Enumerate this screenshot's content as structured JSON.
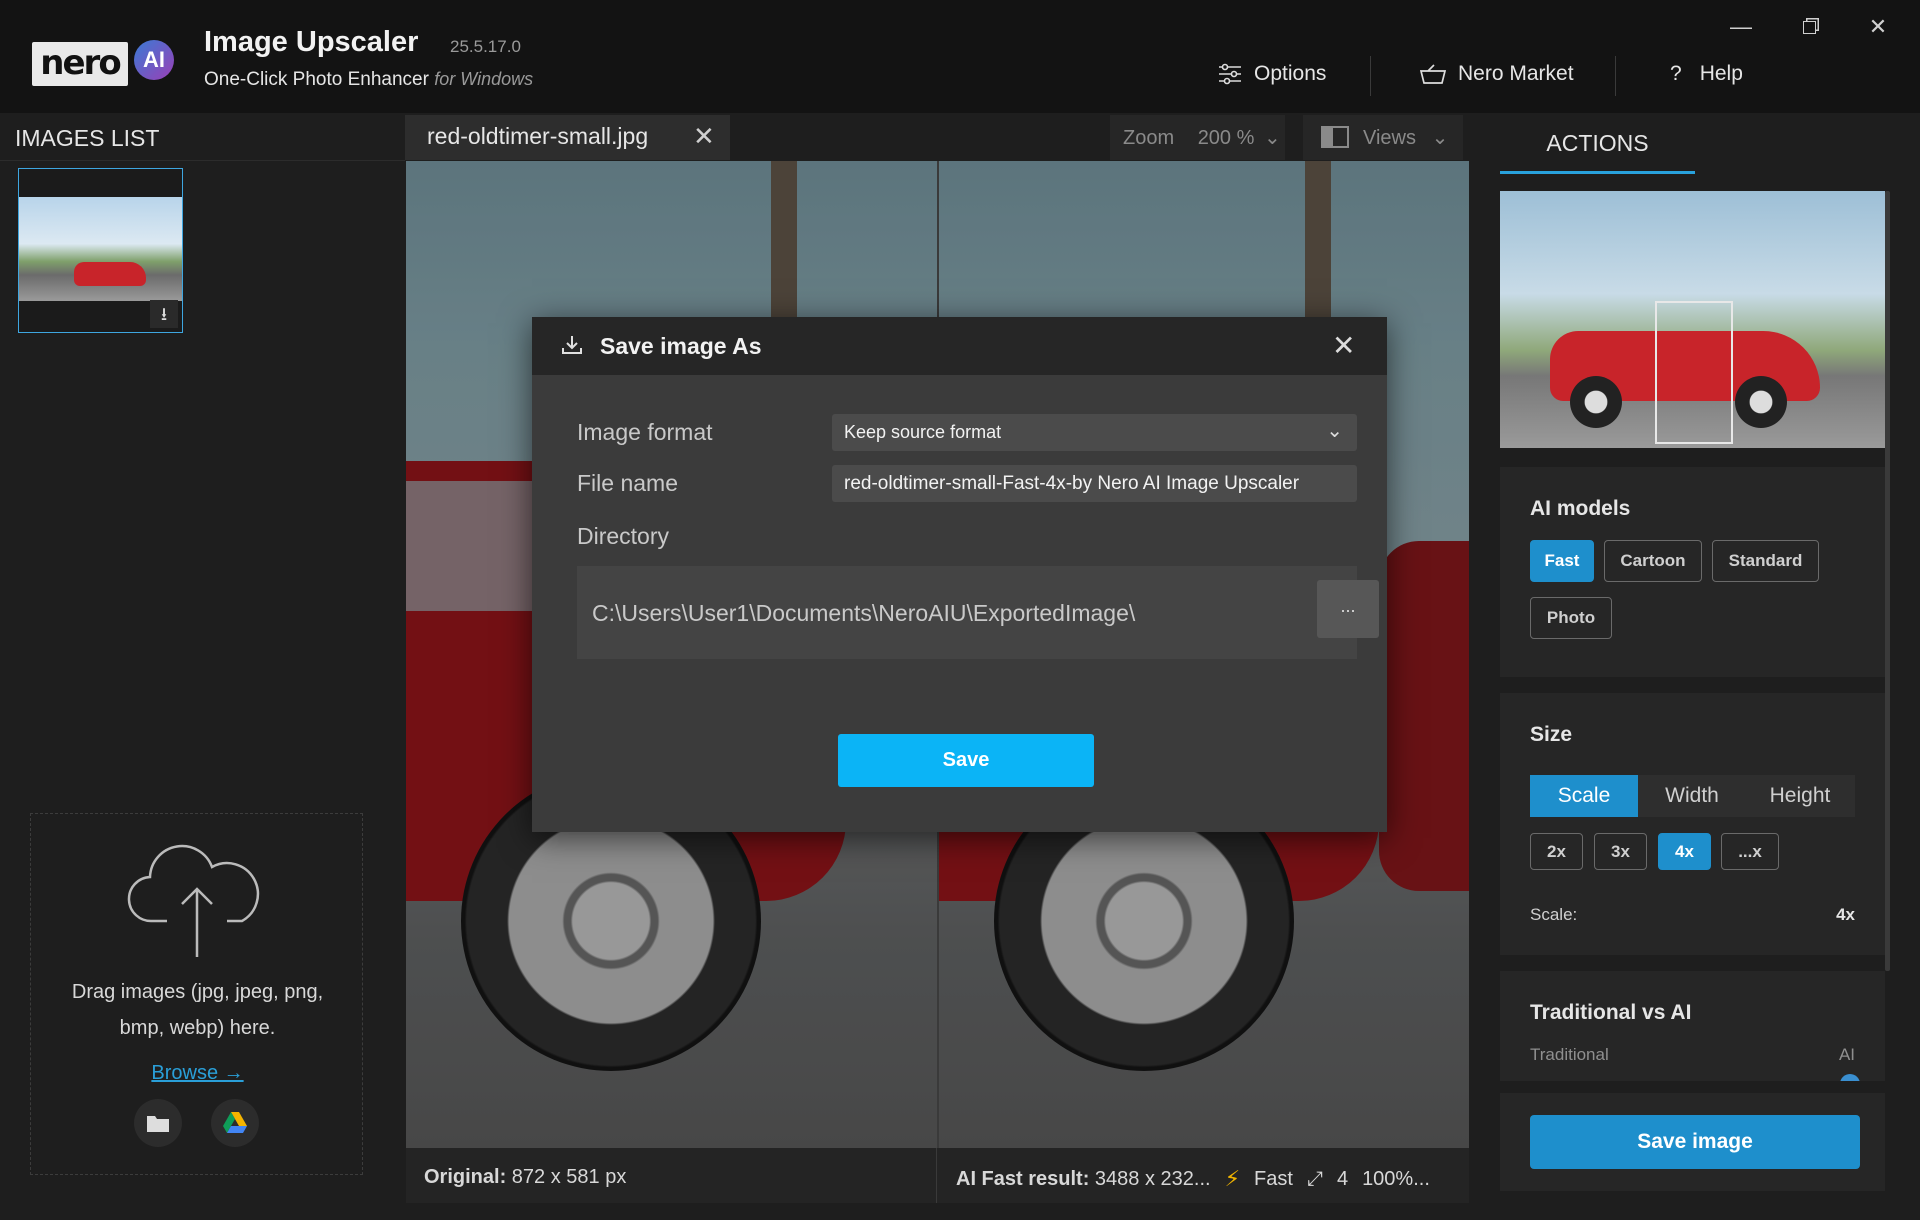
{
  "titlebar": {
    "logo_text": "nero",
    "logo_ai": "AI",
    "app_title": "Image Upscaler",
    "version": "25.5.17.0",
    "subtitle": "One-Click Photo Enhancer",
    "subtitle_platform": "for Windows",
    "nav": [
      {
        "label": "Options",
        "icon": "sliders-icon"
      },
      {
        "label": "Nero Market",
        "icon": "cart-icon"
      },
      {
        "label": "Help",
        "icon": "question-icon"
      }
    ],
    "window_controls": [
      "minimize",
      "restore",
      "close"
    ]
  },
  "images_list": {
    "title": "IMAGES LIST",
    "drop_text_1": "Drag images (jpg, jpeg, png,",
    "drop_text_2": "bmp, webp) here.",
    "browse_label": "Browse →"
  },
  "viewer": {
    "tab_label": "red-oldtimer-small.jpg",
    "zoom_label": "Zoom",
    "zoom_value": "200 %",
    "views_label": "Views",
    "status_original_label": "Original:",
    "status_original_value": "872 x 581 px",
    "status_result_label": "AI Fast result:",
    "status_result_value": "3488 x 232...",
    "status_model": "Fast",
    "status_scale": "4",
    "status_quality": "100%..."
  },
  "actions": {
    "tab_label": "ACTIONS",
    "ai_models_title": "AI models",
    "models": [
      {
        "label": "Fast",
        "active": true
      },
      {
        "label": "Cartoon",
        "active": false
      },
      {
        "label": "Standard",
        "active": false
      },
      {
        "label": "Photo",
        "active": false
      }
    ],
    "size_title": "Size",
    "size_tabs": [
      {
        "label": "Scale",
        "active": true
      },
      {
        "label": "Width",
        "active": false
      },
      {
        "label": "Height",
        "active": false
      }
    ],
    "scale_options": [
      {
        "label": "2x",
        "active": false
      },
      {
        "label": "3x",
        "active": false
      },
      {
        "label": "4x",
        "active": true
      },
      {
        "label": "...x",
        "active": false
      }
    ],
    "scale_label": "Scale:",
    "scale_value": "4x",
    "trad_title": "Traditional vs AI",
    "trad_left": "Traditional",
    "trad_right": "AI",
    "save_image": "Save image"
  },
  "dialog": {
    "title": "Save image As",
    "image_format_label": "Image format",
    "image_format_value": "Keep source format",
    "file_name_label": "File name",
    "file_name_value": "red-oldtimer-small-Fast-4x-by Nero AI Image Upscaler",
    "directory_label": "Directory",
    "directory_value": "C:\\Users\\User1\\Documents\\NeroAIU\\ExportedImage\\",
    "browse_button": "...",
    "save_button": "Save"
  },
  "colors": {
    "accent": "#1e8fcc",
    "save_button": "#0bb4f6",
    "background": "#1e1e1e"
  }
}
